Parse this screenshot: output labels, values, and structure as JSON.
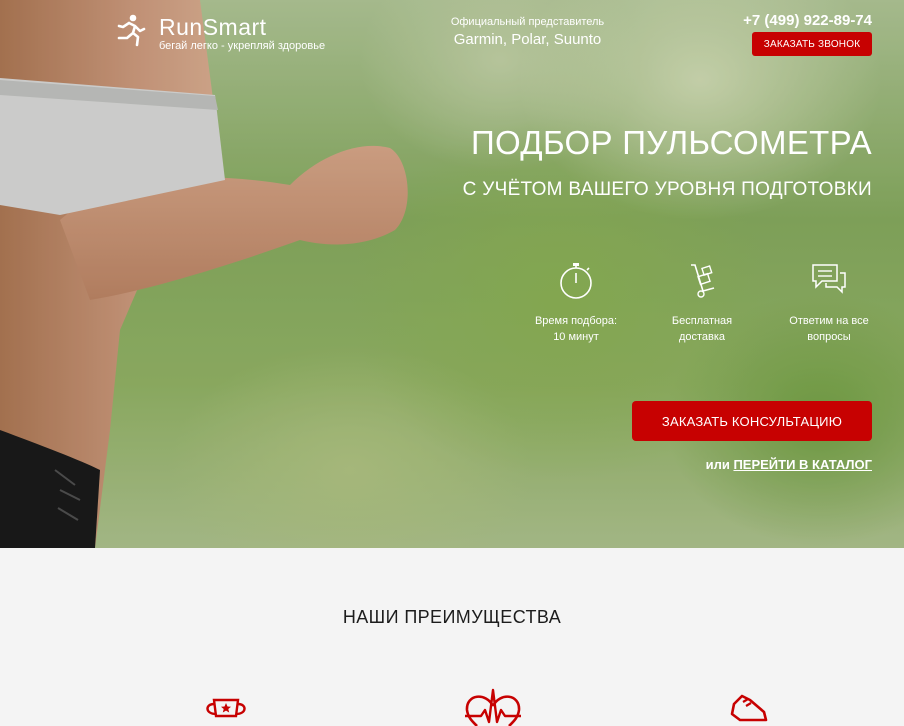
{
  "header": {
    "logo_name": "RunSmart",
    "logo_slogan": "бегай легко - укрепляй здоровье",
    "rep_label": "Официальный представитель",
    "rep_brands": "Garmin, Polar, Suunto",
    "phone": "+7 (499) 922-89-74",
    "call_button": "ЗАКАЗАТЬ ЗВОНОК"
  },
  "hero": {
    "title": "ПОДБОР ПУЛЬСОМЕТРА",
    "subtitle": "С УЧЁТОМ ВАШЕГО УРОВНЯ ПОДГОТОВКИ",
    "features": [
      {
        "icon": "stopwatch-icon",
        "line1": "Время подбора:",
        "line2": "10 минут"
      },
      {
        "icon": "delivery-cart-icon",
        "line1": "Бесплатная",
        "line2": "доставка"
      },
      {
        "icon": "chat-bubbles-icon",
        "line1": "Ответим на все",
        "line2": "вопросы"
      }
    ],
    "consult_button": "ЗАКАЗАТЬ КОНСУЛЬТАЦИЮ",
    "catalog_prefix": "или",
    "catalog_link": "ПЕРЕЙТИ В КАТАЛОГ"
  },
  "advantages": {
    "title": "НАШИ ПРЕИМУЩЕСТВА",
    "icons": [
      "trophy-icon",
      "heartbeat-icon",
      "sneaker-icon"
    ]
  },
  "colors": {
    "accent": "#c70101",
    "text_light": "#ffffff",
    "section_bg": "#f4f4f4"
  }
}
